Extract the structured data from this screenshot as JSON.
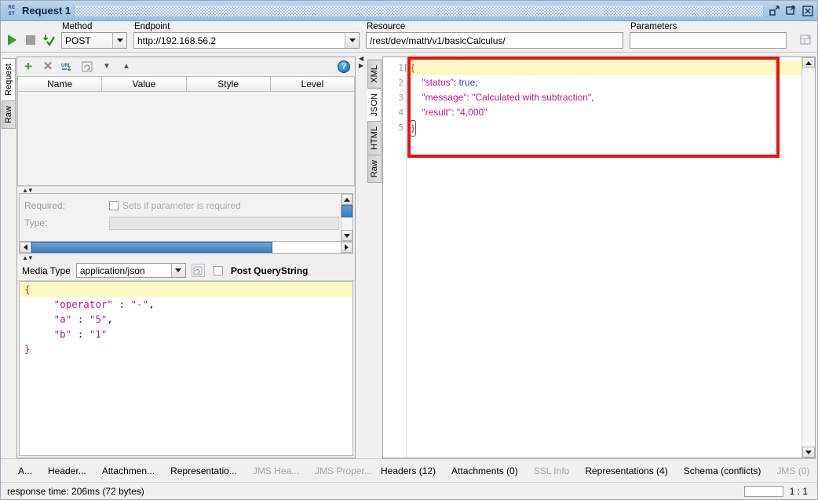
{
  "window": {
    "badge_line1": "RE",
    "badge_line2": "ST",
    "title": "Request 1",
    "restore_icon": "restore-window-icon",
    "maximize_icon": "maximize-window-icon",
    "close_icon": "close-window-icon"
  },
  "toolbar": {
    "run_icon": "run-request-icon",
    "stop_icon": "stop-request-icon",
    "submit_icon": "submit-validate-icon",
    "method": {
      "label": "Method",
      "value": "POST"
    },
    "endpoint": {
      "label": "Endpoint",
      "value": "http://192.168.56.2"
    },
    "resource": {
      "label": "Resource",
      "value": "/rest/dev/math/v1/basicCalculus/"
    },
    "parameters": {
      "label": "Parameters",
      "value": ""
    },
    "filter_icon": "table-filter-icon",
    "add_icon": "add-parameter-icon",
    "help_icon": "help-icon",
    "help_glyph": "?"
  },
  "left_vtabs": [
    {
      "label": "Request",
      "selected": true
    },
    {
      "label": "Raw",
      "selected": false
    }
  ],
  "right_vtabs": [
    {
      "label": "XML",
      "selected": false
    },
    {
      "label": "JSON",
      "selected": true
    },
    {
      "label": "HTML",
      "selected": false
    },
    {
      "label": "Raw",
      "selected": false
    }
  ],
  "params_panel": {
    "toolbar_icons": [
      "add-row-icon",
      "delete-row-icon",
      "url-encode-icon",
      "refresh-icon",
      "move-down-icon",
      "move-up-icon",
      "help-icon"
    ],
    "add_glyph": "+",
    "delete_glyph": "✕",
    "urlenc_glyph": "URL",
    "down_glyph": "▼",
    "up_glyph": "▲",
    "help_glyph": "?",
    "columns": [
      "Name",
      "Value",
      "Style",
      "Level"
    ],
    "rows": []
  },
  "detail_pane": {
    "required_label": "Required:",
    "required_checkbox_text": "Sets if parameter is required",
    "type_label": "Type:",
    "type_value": ""
  },
  "media_row": {
    "label": "Media Type",
    "value": "application/json",
    "format_icon": "format-json-icon",
    "post_querystring_label": "Post QueryString",
    "post_querystring_checked": false
  },
  "request_body": {
    "lines": [
      {
        "text": "{",
        "highlight": true
      },
      {
        "text": "     \"operator\" : \"-\",",
        "highlight": false
      },
      {
        "text": "     \"a\" : \"5\",",
        "highlight": false
      },
      {
        "text": "     \"b\" : \"1\"",
        "highlight": false
      },
      {
        "text": "}",
        "highlight": false
      }
    ],
    "raw": "{\n     \"operator\" : \"-\",\n     \"a\" : \"5\",\n     \"b\" : \"1\"\n}"
  },
  "response_body": {
    "line_numbers": [
      "1",
      "2",
      "3",
      "4",
      "5"
    ],
    "fold_glyph": "−",
    "lines": [
      "{",
      "    \"status\": true,",
      "    \"message\": \"Calculated with subtraction\",",
      "    \"result\": \"4,000\"",
      "}"
    ],
    "parsed": {
      "status": true,
      "message": "Calculated with subtraction",
      "result": "4,000"
    },
    "highlight_color": "#fdf9c4",
    "annotation_box_color": "#e8120f"
  },
  "bottom_tabs_left": [
    {
      "label": "A...",
      "dim": false
    },
    {
      "label": "Header...",
      "dim": false
    },
    {
      "label": "Attachmen...",
      "dim": false
    },
    {
      "label": "Representatio...",
      "dim": false
    },
    {
      "label": "JMS Hea...",
      "dim": true
    },
    {
      "label": "JMS Proper...",
      "dim": true
    }
  ],
  "bottom_tabs_right": [
    {
      "label": "Headers (12)",
      "dim": false
    },
    {
      "label": "Attachments (0)",
      "dim": false
    },
    {
      "label": "SSL Info",
      "dim": true
    },
    {
      "label": "Representations (4)",
      "dim": false
    },
    {
      "label": "Schema (conflicts)",
      "dim": false
    },
    {
      "label": "JMS (0)",
      "dim": true
    }
  ],
  "statusbar": {
    "response_time": "response time: 206ms (72 bytes)",
    "caret_position": "1 : 1"
  }
}
